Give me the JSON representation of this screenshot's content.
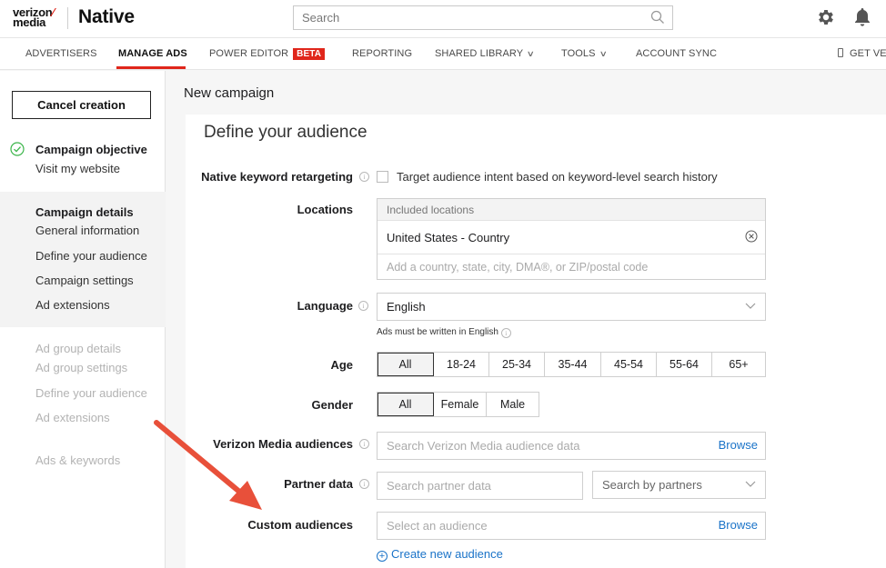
{
  "header": {
    "logo_line1": "verizon",
    "logo_line2": "media",
    "product": "Native",
    "search_placeholder": "Search"
  },
  "nav": {
    "items": [
      "ADVERTISERS",
      "MANAGE ADS",
      "POWER EDITOR",
      "REPORTING",
      "SHARED LIBRARY",
      "TOOLS",
      "ACCOUNT SYNC",
      "GET VE"
    ],
    "beta": "BETA",
    "accent": "#e0261b"
  },
  "sidebar": {
    "cancel_label": "Cancel creation",
    "objective_title": "Campaign objective",
    "objective_value": "Visit my website",
    "details_title": "Campaign details",
    "details_items": [
      "General information",
      "Define your audience",
      "Campaign settings",
      "Ad extensions"
    ],
    "adgroup_title": "Ad group details",
    "adgroup_items": [
      "Ad group settings",
      "Define your audience",
      "Ad extensions"
    ],
    "ads_title": "Ads & keywords"
  },
  "main": {
    "page_title": "New campaign",
    "section_title": "Define your audience",
    "keyword": {
      "label": "Native keyword retargeting",
      "checkbox_label": "Target audience intent based on keyword-level search history"
    },
    "locations": {
      "label": "Locations",
      "header": "Included locations",
      "item": "United States - Country",
      "placeholder": "Add a country, state, city, DMA®, or ZIP/postal code"
    },
    "language": {
      "label": "Language",
      "value": "English",
      "hint": "Ads must be written in English"
    },
    "age": {
      "label": "Age",
      "options": [
        "All",
        "18-24",
        "25-34",
        "35-44",
        "45-54",
        "55-64",
        "65+"
      ],
      "selected": "All"
    },
    "gender": {
      "label": "Gender",
      "options": [
        "All",
        "Female",
        "Male"
      ],
      "selected": "All"
    },
    "verizon_audiences": {
      "label": "Verizon Media audiences",
      "placeholder": "Search Verizon Media audience data",
      "browse": "Browse"
    },
    "partner": {
      "label": "Partner data",
      "placeholder": "Search partner data",
      "select": "Search by partners"
    },
    "custom": {
      "label": "Custom audiences",
      "placeholder": "Select an audience",
      "browse": "Browse",
      "create": "Create new audience"
    }
  },
  "annotation_color": "#e8503a"
}
